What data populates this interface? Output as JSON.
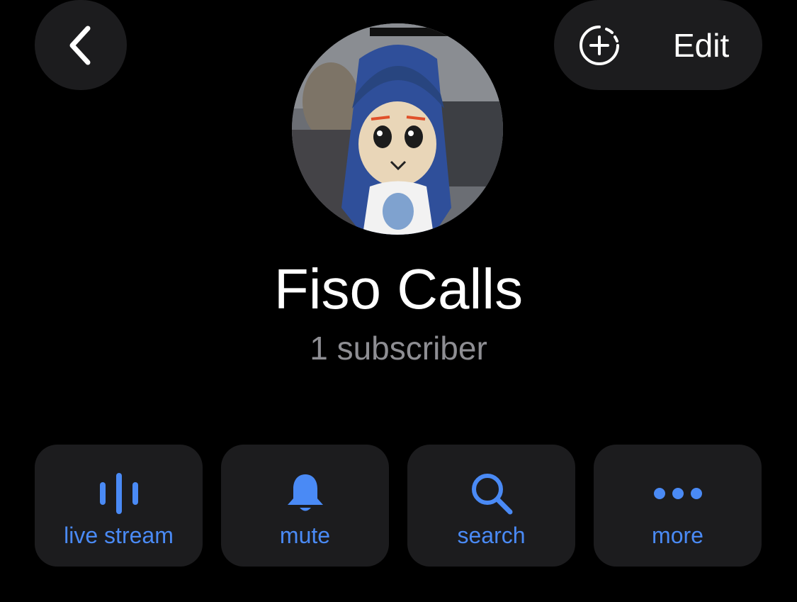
{
  "header": {
    "back_icon": "chevron-left-icon",
    "edit_label": "Edit",
    "story_icon": "add-story-icon"
  },
  "profile": {
    "avatar": "channel-avatar-image",
    "name": "Fiso Calls",
    "subscribers": "1 subscriber"
  },
  "actions": [
    {
      "label": "live stream",
      "icon": "audio-bars-icon"
    },
    {
      "label": "mute",
      "icon": "bell-icon"
    },
    {
      "label": "search",
      "icon": "search-icon"
    },
    {
      "label": "more",
      "icon": "ellipsis-icon"
    }
  ],
  "colors": {
    "background": "#000000",
    "button_bg": "#1c1c1e",
    "accent": "#4a8af5",
    "secondary_text": "#8e8e93"
  }
}
